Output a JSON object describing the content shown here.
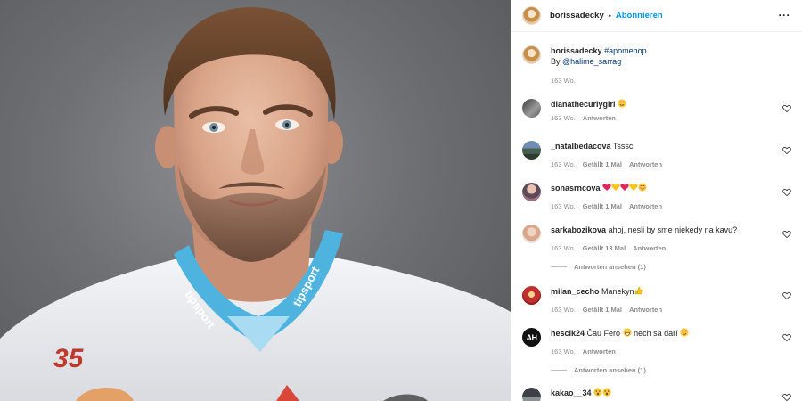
{
  "post": {
    "owner_username": "borissadecky",
    "follow_label": "Abonnieren",
    "more_icon": "more-horizontal-icon",
    "caption": {
      "username": "borissadecky",
      "hashtag": "#apomehop",
      "by_prefix": "By",
      "mention": "@halime_sarrag",
      "time": "163 Wo."
    },
    "photo": {
      "jersey_number": "35",
      "collar_brand": "tipsport"
    }
  },
  "colors": {
    "accent_blue": "#0095f6",
    "muted": "#8e8e8e",
    "collar_blue": "#4fb3e0"
  },
  "comments": [
    {
      "username": "dianathecurlygirl",
      "text": "",
      "emojis": [
        "heart-eyes"
      ],
      "time": "163 Wo.",
      "likes": "",
      "reply_label": "Antworten"
    },
    {
      "username": "_natalbedacova",
      "text": "Tsssc",
      "emojis": [],
      "time": "163 Wo.",
      "likes": "Gefällt 1 Mal",
      "reply_label": "Antworten"
    },
    {
      "username": "sonasrncova",
      "text": "",
      "emojis": [
        "red-heart",
        "yellow-heart",
        "red-heart",
        "yellow-heart",
        "blush"
      ],
      "time": "163 Wo.",
      "likes": "Gefällt 1 Mal",
      "reply_label": "Antworten"
    },
    {
      "username": "sarkabozikova",
      "text": "ahoj, nesli by sme niekedy na kavu?",
      "emojis": [],
      "time": "163 Wo.",
      "likes": "Gefällt 13 Mal",
      "reply_label": "Antworten",
      "view_replies": "Antworten ansehen (1)"
    },
    {
      "username": "milan_cecho",
      "text": "Manekyn",
      "emojis": [
        "thumbs-up"
      ],
      "time": "163 Wo.",
      "likes": "Gefällt 1 Mal",
      "reply_label": "Antworten"
    },
    {
      "username": "hescik24",
      "text_before": "Čau Fero",
      "text_after": "nech sa darí",
      "emojis_mid": [
        "grin"
      ],
      "emojis_end": [
        "heart-eyes"
      ],
      "time": "163 Wo.",
      "likes": "",
      "reply_label": "Antworten",
      "view_replies": "Antworten ansehen (1)",
      "avatar_text": "AH"
    },
    {
      "username": "kakao__34",
      "text": "",
      "emojis": [
        "astonished",
        "astonished"
      ]
    }
  ]
}
